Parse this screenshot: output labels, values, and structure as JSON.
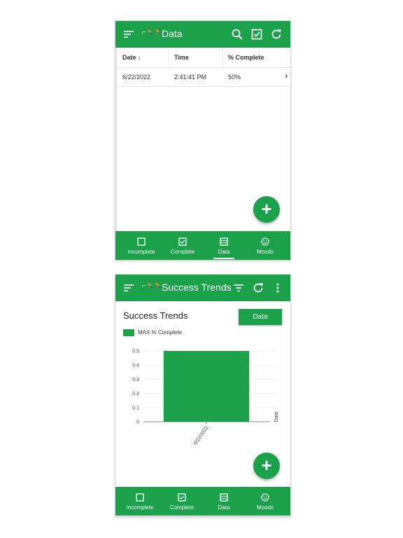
{
  "colors": {
    "accent": "#1aa14a",
    "text": "#212121"
  },
  "screen1": {
    "appbar": {
      "logo": "⌐🏃🏃",
      "title": "Data",
      "icons": [
        "menu-icon",
        "search-icon",
        "checkbox-icon",
        "refresh-icon"
      ]
    },
    "table": {
      "headers": [
        "Date ↓",
        "Time",
        "% Complete"
      ],
      "rows": [
        {
          "date": "6/22/2022",
          "time": "2:41:41 PM",
          "complete": "50%",
          "chevron": "›"
        }
      ]
    },
    "fab": "+",
    "nav": [
      {
        "label": "Incomplete",
        "icon": "square-icon",
        "selected": false
      },
      {
        "label": "Complete",
        "icon": "checked-square-icon",
        "selected": false
      },
      {
        "label": "Data",
        "icon": "table-icon",
        "selected": true
      },
      {
        "label": "Moods",
        "icon": "smiley-icon",
        "selected": false
      }
    ]
  },
  "screen2": {
    "appbar": {
      "logo": "⌐🏃🏃",
      "title": "Success Trends",
      "icons": [
        "menu-icon",
        "filter-icon",
        "refresh-icon",
        "more-vert-icon"
      ]
    },
    "card_title": "Success Trends",
    "data_button": "Data",
    "legend": "MAX % Complete",
    "fab": "+",
    "nav": [
      {
        "label": "Incomplete",
        "icon": "square-icon"
      },
      {
        "label": "Complete",
        "icon": "checked-square-icon"
      },
      {
        "label": "Data",
        "icon": "table-icon"
      },
      {
        "label": "Moods",
        "icon": "smiley-icon"
      }
    ]
  },
  "chart_data": {
    "type": "bar",
    "categories": [
      "6/22/2022"
    ],
    "series": [
      {
        "name": "MAX % Complete",
        "values": [
          0.5
        ]
      }
    ],
    "yticks": [
      "0",
      "0.1",
      "0.2",
      "0.3",
      "0.4",
      "0.5"
    ],
    "ylim": [
      0,
      0.5
    ],
    "xlabel": "Date",
    "ylabel": "",
    "grid": true,
    "legend": "top-left"
  }
}
